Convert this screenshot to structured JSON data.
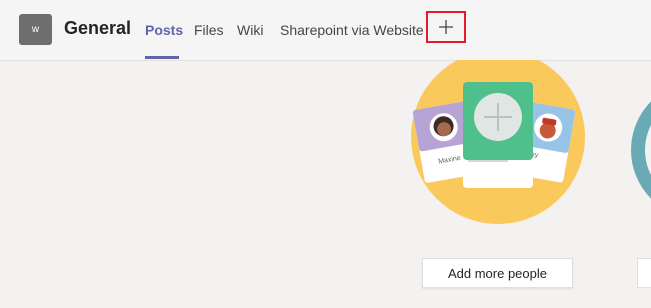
{
  "header": {
    "avatar_initial": "w",
    "team_name": "General",
    "tabs": [
      {
        "label": "Posts"
      },
      {
        "label": "Files"
      },
      {
        "label": "Wiki"
      },
      {
        "label": "Sharepoint via Website"
      }
    ],
    "add_tab_icon": "plus-icon"
  },
  "illustration": {
    "card_names": [
      "Maxine",
      "ky"
    ]
  },
  "actions": {
    "add_people_label": "Add more people"
  },
  "colors": {
    "accent": "#6264a7",
    "highlight_border": "#e8192c",
    "illustration_yellow": "#f9c95c",
    "card_green": "#4fc08c"
  }
}
